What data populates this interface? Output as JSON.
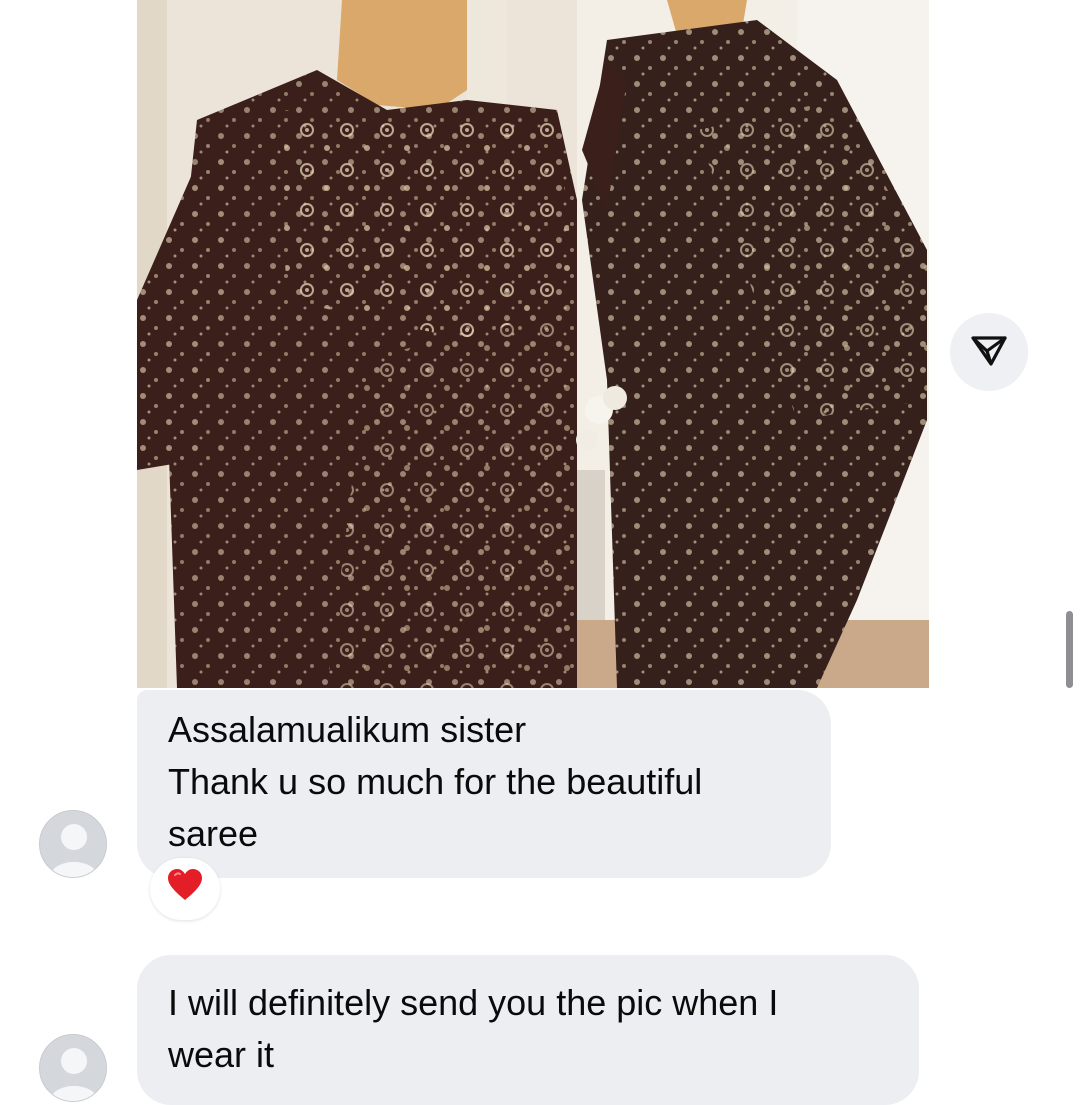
{
  "messages": [
    {
      "lines": [
        "Assalamualikum sister",
        "Thank u so much for the beautiful",
        "saree"
      ],
      "reaction": "❤️"
    },
    {
      "lines": [
        "I will definitely send you the pic when I",
        "wear it"
      ]
    }
  ],
  "icons": {
    "share": "paper-plane-icon",
    "avatar": "default-user-icon",
    "reaction": "red-heart"
  },
  "colors": {
    "bubble": "#eceef2",
    "saree": "#3b1f1a",
    "embroidery": "#e6d6b8",
    "heart": "#e41e26"
  }
}
